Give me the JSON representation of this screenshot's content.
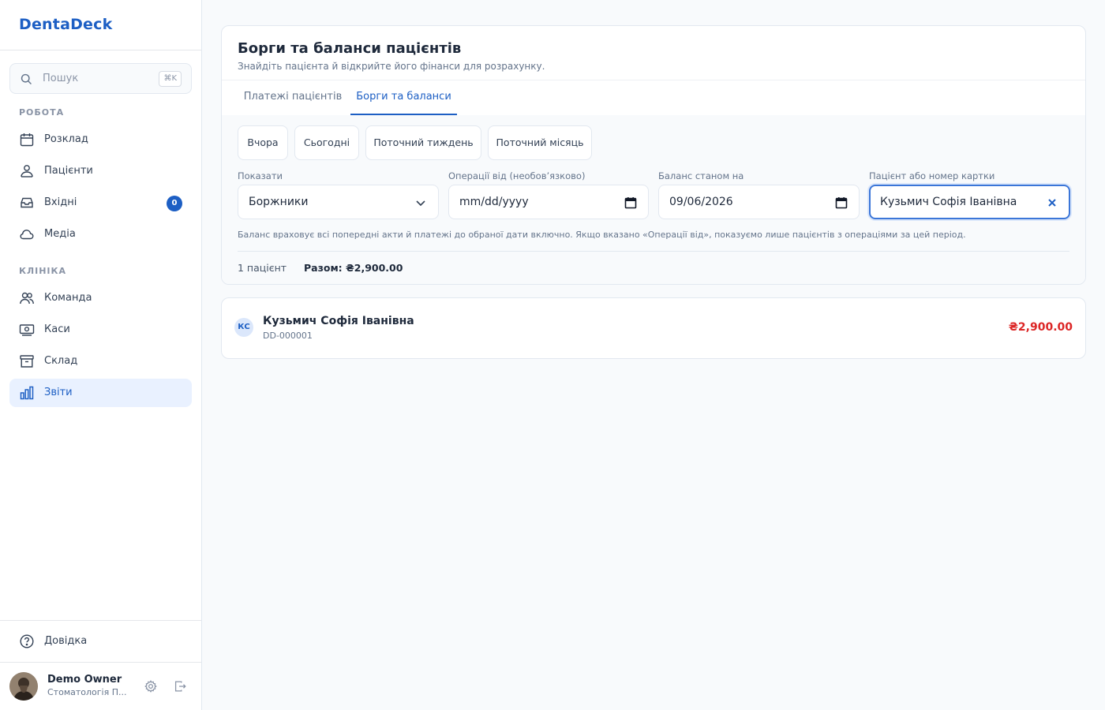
{
  "app": {
    "name": "DentaDeck"
  },
  "sidebar": {
    "search": {
      "placeholder": "Пошук",
      "shortcut": "⌘K"
    },
    "sections": [
      {
        "label": "РОБОТА",
        "items": [
          {
            "label": "Розклад",
            "icon": "calendar-icon"
          },
          {
            "label": "Пацієнти",
            "icon": "patients-icon"
          },
          {
            "label": "Вхідні",
            "icon": "inbox-icon",
            "badge": "0"
          },
          {
            "label": "Медіа",
            "icon": "cloud-icon"
          }
        ]
      },
      {
        "label": "КЛІНІКА",
        "items": [
          {
            "label": "Команда",
            "icon": "team-icon"
          },
          {
            "label": "Каси",
            "icon": "cash-register-icon"
          },
          {
            "label": "Склад",
            "icon": "archive-icon"
          },
          {
            "label": "Звіти",
            "icon": "bar-chart-icon",
            "active": true
          }
        ]
      }
    ],
    "help": {
      "label": "Довідка",
      "icon": "help-circle-icon"
    },
    "user": {
      "name": "Demo Owner",
      "org": "Стоматологія П..."
    }
  },
  "page": {
    "title": "Борги та баланси пацієнтів",
    "subtitle": "Знайдіть пацієнта й відкрийте його фінанси для розрахунку.",
    "tabs": [
      {
        "label": "Платежі пацієнтів",
        "active": false
      },
      {
        "label": "Борги та баланси",
        "active": true
      }
    ],
    "quick_ranges": [
      "Вчора",
      "Сьогодні",
      "Поточний тиждень",
      "Поточний місяць"
    ],
    "filters": {
      "show": {
        "label": "Показати",
        "value": "Боржники"
      },
      "from": {
        "label": "Операції від (необов’язково)",
        "value": "mm/dd/yyyy"
      },
      "as_of": {
        "label": "Баланс станом на",
        "value": "09/06/2026"
      },
      "patient": {
        "label": "Пацієнт або номер картки",
        "value": "Кузьмич Софія Іванівна"
      }
    },
    "hint": "Баланс враховує всі попередні акти й платежі до обраної дати включно. Якщо вказано «Операції від», показуємо лише пацієнтів з операціями за цей період.",
    "summary": {
      "count": "1 пацієнт",
      "total": "Разом: ₴2,900.00"
    },
    "results": [
      {
        "initials": "КС",
        "name": "Кузьмич Софія Іванівна",
        "card": "DD-000001",
        "amount": "₴2,900.00"
      }
    ]
  },
  "colors": {
    "accent": "#1d5fc4",
    "debt": "#dc2626"
  }
}
